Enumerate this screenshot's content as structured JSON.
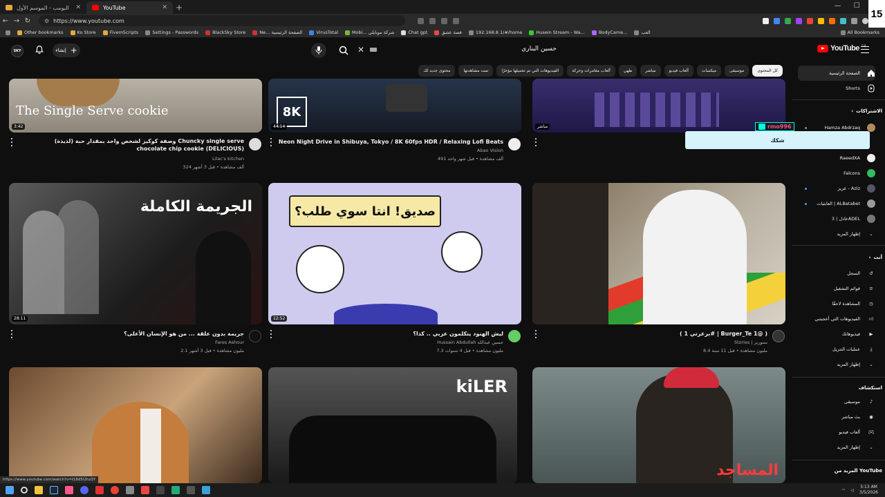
{
  "browser": {
    "tabs": [
      {
        "label": "بنات البومب - الموسم الأول | Ep#12",
        "active": false
      },
      {
        "label": "YouTube",
        "active": true
      }
    ],
    "url": "https://www.youtube.com",
    "bookmarks": [
      "Other bookmarks",
      "Ko Store",
      "FivemScripts",
      "Settings - Passwords",
      "BlackSky Store",
      "Ne... الصفحة الرئيسية",
      "VirusTotal",
      "Mobi... شركة موبايلي",
      "Chat gpt",
      "قصة عشق",
      "192.168.8.1/#/home",
      "Husein Stream - Wa...",
      "BodyCame...",
      "العب"
    ],
    "all_bookmarks": "All Bookmarks",
    "status_url": "https://www.youtube.com/watch?v=t18d5l2tuQY"
  },
  "header": {
    "avatar_text": "SKY",
    "create_label": "إنشاء",
    "search_value": "حسين البناري",
    "logo_text": "YouTube",
    "logo_country": "SA"
  },
  "chips": [
    {
      "label": "كل المحتوى",
      "active": true
    },
    {
      "label": "موسيقى",
      "active": false
    },
    {
      "label": "ميكسات",
      "active": false
    },
    {
      "label": "ألعاب فيديو",
      "active": false
    },
    {
      "label": "مباشر",
      "active": false
    },
    {
      "label": "طهي",
      "active": false
    },
    {
      "label": "ألعاب مغامرات وحركة",
      "active": false
    },
    {
      "label": "الفيديوهات التي تم تحميلها مؤخرًا",
      "active": false
    },
    {
      "label": "تمت مشاهدتها",
      "active": false
    },
    {
      "label": "محتوى جديد لك",
      "active": false
    }
  ],
  "videos": [
    {
      "title": "وصفة كوكيز لشخص واحد بمقدار حبة (لذيذة) Chuncky single serve chocolate chip cookie (DELICIOUS)",
      "channel": "Lilac's kitchen",
      "stats": "324 ألف مشاهدة • قبل 3 أشهر",
      "duration": "3:42",
      "thumb_text": "The Single Serve cookie"
    },
    {
      "title": "Neon Night Drive in Shibuya, Tokyo / 8K 60fps HDR / Relaxing Lofi Beats",
      "channel": "Abao Vision",
      "stats": "491 ألف مشاهدة • قبل شهر واحد",
      "duration": "44:14",
      "thumb_text": "8K"
    },
    {
      "title": "",
      "channel": "",
      "stats": "",
      "duration": "",
      "thumb_text": "مباشر"
    },
    {
      "title": "جريمة بدون علقة ... من هو الإنسان الأعلى؟",
      "channel": "Fares Ashour",
      "stats": "2.1 مليون مشاهدة • قبل 3 أشهر",
      "duration": "28:11",
      "thumb_text": "الجريمة الكاملة"
    },
    {
      "title": "ليش الهنود يتكلمون عربي .. كذا؟",
      "channel": "Hussain Abdullah حسين عبدالله",
      "stats": "7.3 مليون مشاهدة • قبل 4 سنوات",
      "duration": "12:52",
      "thumb_text": "صديق! انتا سوي طلب؟"
    },
    {
      "title": "( برغرتي 1# | Burger_Te 1@ )",
      "channel": "Stories | ستوريز",
      "stats": "8.4 مليون مشاهدة • قبل 11 سنة",
      "duration": "",
      "thumb_text": ""
    },
    {
      "title": "",
      "channel": "",
      "stats": "",
      "duration": "",
      "thumb_text": ""
    },
    {
      "title": "",
      "channel": "",
      "stats": "",
      "duration": "",
      "thumb_text": "kiLER"
    },
    {
      "title": "",
      "channel": "",
      "stats": "",
      "duration": "",
      "thumb_text": "المساجد"
    }
  ],
  "sidebar": {
    "home": "الصفحة الرئيسية",
    "shorts": "Shorts",
    "subscriptions_heading": "الاشتراكات",
    "subscriptions": [
      "Hamza Abdrzaq",
      "RaeedXA",
      "Falcons",
      "عزيز - Aziz",
      "العابثيات | ALBatabet",
      "عادل | 3ADEL"
    ],
    "show_more": "إظهار المزيد",
    "you_heading": "أنت",
    "you_items": [
      "السجل",
      "قوائم التشغيل",
      "المشاهدة لاحقًا",
      "الفيديوهات التي أعجبتني",
      "فيديوهاتك",
      "عمليات التنزيل"
    ],
    "show_more_2": "إظهار المزيد",
    "explore_heading": "استكشاف",
    "explore_items": [
      "موسيقى",
      "بث مباشر",
      "ألعاب فيديو"
    ],
    "show_more_3": "إظهار المزيد",
    "more_heading": "المزيد من YouTube"
  },
  "overlay": {
    "username": "rmo996",
    "message": "شكك"
  },
  "taskbar": {
    "time": "5:13 AM",
    "date": "3/5/2026"
  },
  "corner_badge": "15",
  "colors": {
    "background": "#0f0f0f",
    "chip_active": "#f1f1f1",
    "yt_red": "#ff0000",
    "popup": "#d6f3fb"
  }
}
